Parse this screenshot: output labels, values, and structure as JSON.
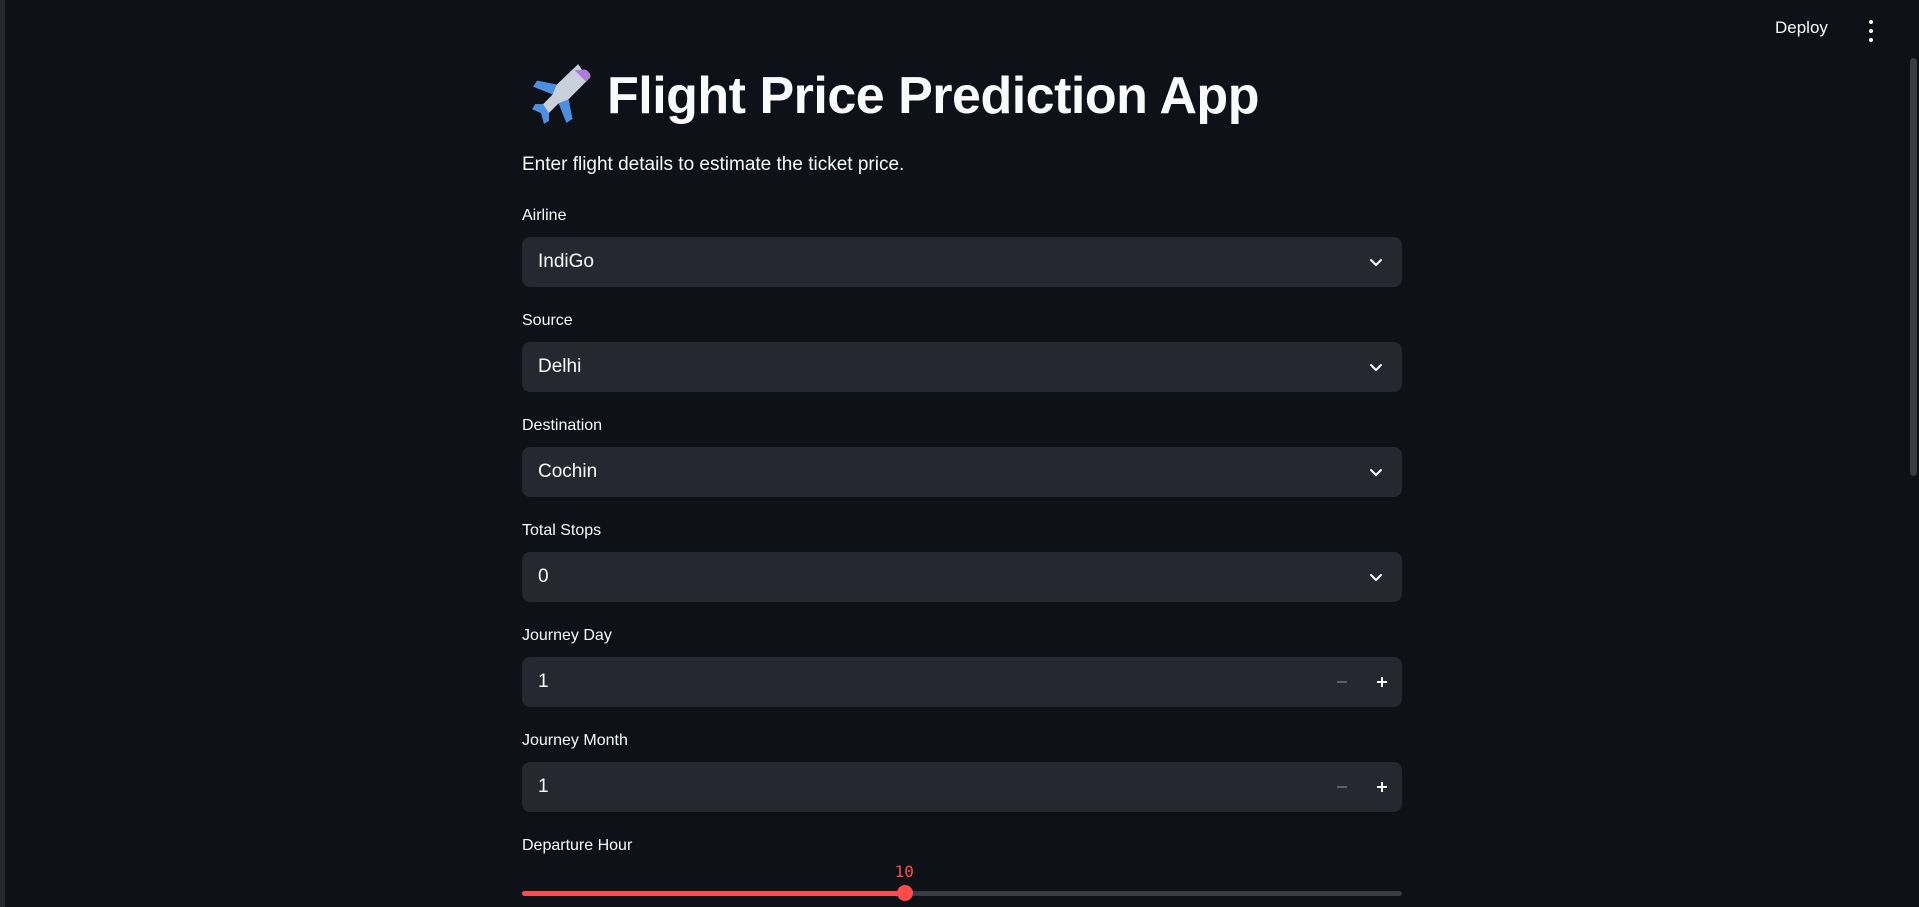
{
  "header": {
    "deploy_label": "Deploy"
  },
  "page": {
    "title": "Flight Price Prediction App",
    "subtitle": "Enter flight details to estimate the ticket price."
  },
  "fields": {
    "airline": {
      "label": "Airline",
      "value": "IndiGo"
    },
    "source": {
      "label": "Source",
      "value": "Delhi"
    },
    "destination": {
      "label": "Destination",
      "value": "Cochin"
    },
    "total_stops": {
      "label": "Total Stops",
      "value": "0"
    },
    "journey_day": {
      "label": "Journey Day",
      "value": "1"
    },
    "journey_month": {
      "label": "Journey Month",
      "value": "1"
    },
    "departure_hour": {
      "label": "Departure Hour",
      "value": "10",
      "min": 0,
      "max": 23
    }
  },
  "icons": {
    "title_icon": "airplane-icon",
    "select_icon": "chevron-down-icon",
    "minus_icon": "minus-icon",
    "plus_icon": "plus-icon",
    "menu_icon": "kebab-menu-icon"
  },
  "colors": {
    "background": "#0e1117",
    "input_bg": "#262730",
    "accent": "#ff4b4b",
    "text": "#fafafa"
  }
}
